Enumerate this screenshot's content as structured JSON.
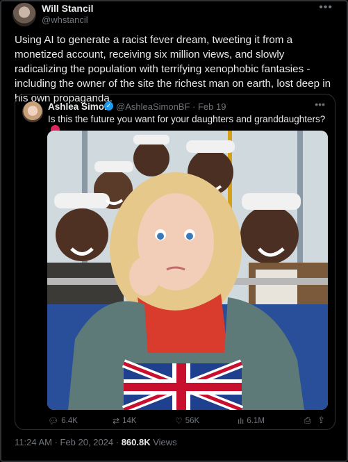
{
  "author": {
    "name": "Will Stancil",
    "handle": "@whstancil"
  },
  "tweet": {
    "text": "Using AI to generate a racist fever dream, tweeting it from a monetized account, receiving six million views, and slowly radicalizing the population with terrifying xenophobic fantasies - including the owner of the site the richest man on earth, lost deep in his own propaganda."
  },
  "quote": {
    "name": "Ashlea Simon",
    "handle_date": "@AshleaSimonBF · Feb 19",
    "text": "Is this the future you want for your daughters and granddaughters?",
    "stats": {
      "replies": "6.4K",
      "retweets": "14K",
      "likes": "56K",
      "views": "6.1M"
    }
  },
  "meta": {
    "time_date": "11:24 AM · Feb 20, 2024 · ",
    "views_count": "860.8K",
    "views_label": " Views"
  },
  "icons": {
    "more": "more-dots-icon",
    "verified": "verified-badge-icon",
    "reply": "reply-icon",
    "retweet": "retweet-icon",
    "like": "heart-icon",
    "views": "bar-chart-icon",
    "bookmark": "bookmark-icon",
    "share": "share-icon"
  },
  "colors": {
    "accent": "#1d9bf0",
    "muted": "#71767b",
    "text": "#e7e9ea",
    "background": "#000000",
    "border": "#2f3336"
  }
}
